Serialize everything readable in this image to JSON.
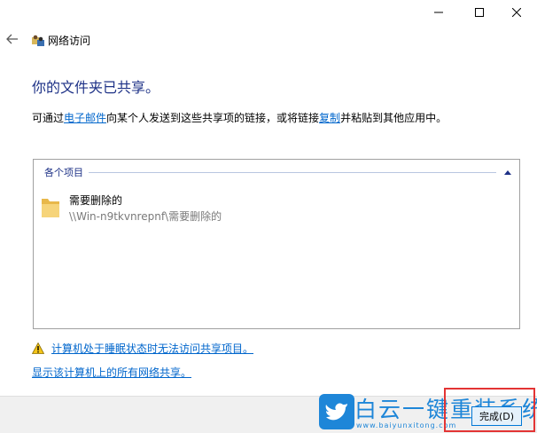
{
  "window": {
    "title": "网络访问"
  },
  "main": {
    "headline": "你的文件夹已共享。",
    "desc_prefix": "可通过",
    "desc_link_email": "电子邮件",
    "desc_middle": "向某个人发送到这些共享项的链接，或将链接",
    "desc_link_copy": "复制",
    "desc_suffix": "并粘贴到其他应用中。"
  },
  "list": {
    "group_label": "各个项目",
    "items": [
      {
        "name": "需要删除的",
        "path": "\\\\Win-n9tkvnrepnf\\需要删除的"
      }
    ]
  },
  "links": {
    "sleep_warning": "计算机处于睡眠状态时无法访问共享项目。",
    "show_all_shares": "显示该计算机上的所有网络共享。"
  },
  "footer": {
    "finish_label": "完成(D)"
  },
  "watermark": {
    "text": "白云一键重装系统",
    "url": "www.baiyunxitong.com"
  },
  "colors": {
    "headline": "#1e3287",
    "link": "#0066cc",
    "highlight": "#e33434",
    "watermark": "#1e86d8"
  },
  "icons": {
    "back": "back-arrow-icon",
    "app": "network-users-icon",
    "folder": "folder-icon",
    "warning": "warning-icon",
    "chevron": "chevron-up-icon",
    "minimize": "minimize-icon",
    "maximize": "maximize-icon",
    "close": "close-icon"
  }
}
